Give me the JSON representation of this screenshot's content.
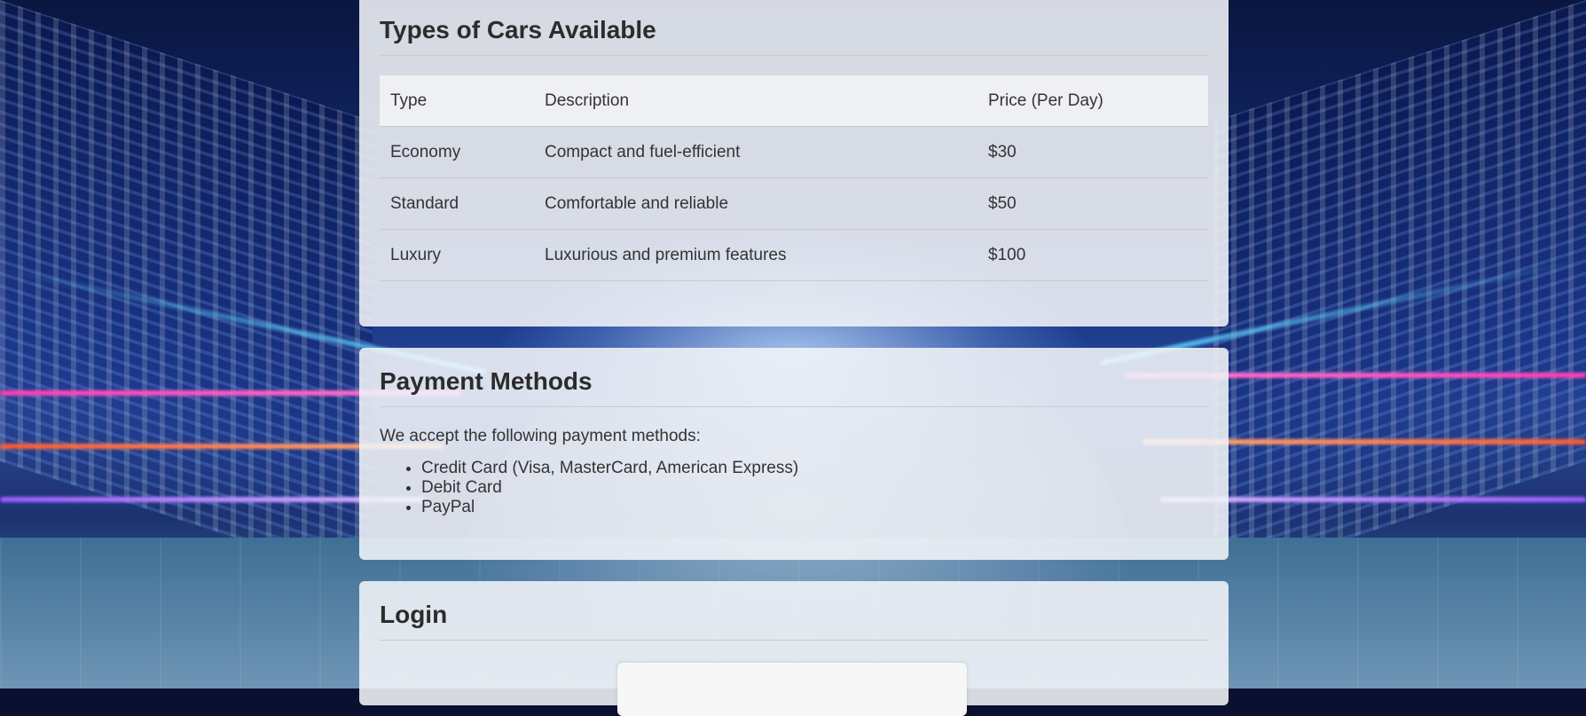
{
  "cars_section": {
    "title": "Types of Cars Available",
    "headers": [
      "Type",
      "Description",
      "Price (Per Day)"
    ],
    "rows": [
      {
        "type": "Economy",
        "description": "Compact and fuel-efficient",
        "price": "$30"
      },
      {
        "type": "Standard",
        "description": "Comfortable and reliable",
        "price": "$50"
      },
      {
        "type": "Luxury",
        "description": "Luxurious and premium features",
        "price": "$100"
      }
    ]
  },
  "payment_section": {
    "title": "Payment Methods",
    "intro": "We accept the following payment methods:",
    "methods": [
      "Credit Card (Visa, MasterCard, American Express)",
      "Debit Card",
      "PayPal"
    ]
  },
  "login_section": {
    "title": "Login"
  }
}
